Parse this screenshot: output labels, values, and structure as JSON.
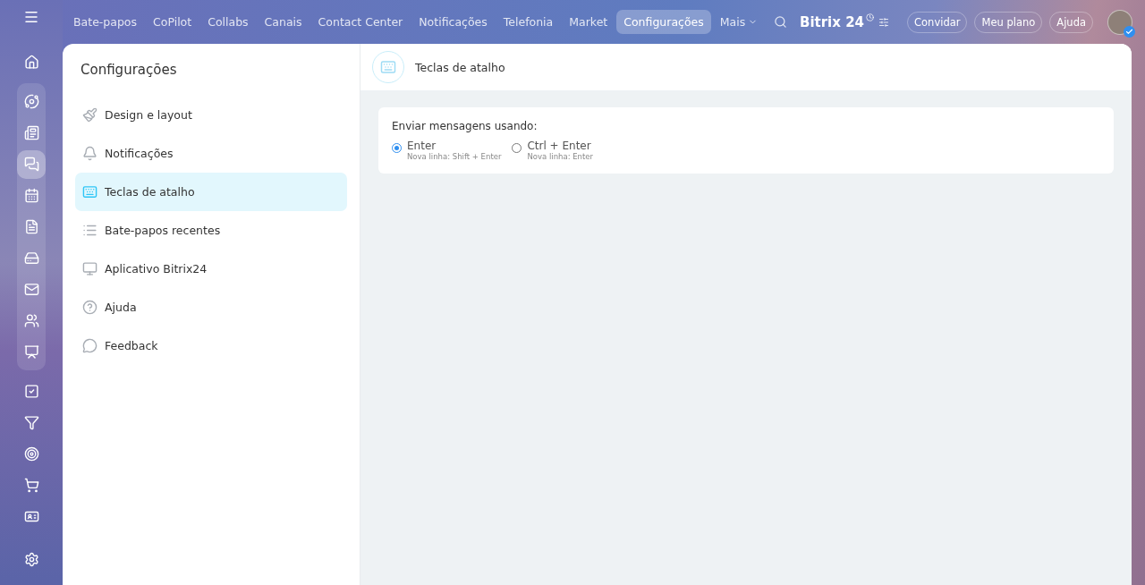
{
  "rail": {
    "top": [
      {
        "kind": "home",
        "selected": false
      }
    ],
    "group": [
      {
        "kind": "collab",
        "selected": false
      },
      {
        "kind": "feed",
        "selected": false
      },
      {
        "kind": "chat",
        "selected": true
      },
      {
        "kind": "calendar",
        "selected": false
      },
      {
        "kind": "document",
        "selected": false
      },
      {
        "kind": "drive",
        "selected": false
      },
      {
        "kind": "mail",
        "selected": false
      },
      {
        "kind": "people",
        "selected": false
      },
      {
        "kind": "board",
        "selected": false
      }
    ],
    "bottom": [
      {
        "kind": "tasks",
        "selected": false
      },
      {
        "kind": "funnel",
        "selected": false
      },
      {
        "kind": "target",
        "selected": false
      },
      {
        "kind": "cart",
        "selected": false
      },
      {
        "kind": "card",
        "selected": false
      }
    ]
  },
  "topnav": {
    "items": [
      {
        "label": "Bate-papos",
        "selected": false
      },
      {
        "label": "CoPilot",
        "selected": false
      },
      {
        "label": "Collabs",
        "selected": false
      },
      {
        "label": "Canais",
        "selected": false
      },
      {
        "label": "Contact Center",
        "selected": false
      },
      {
        "label": "Notificações",
        "selected": false
      },
      {
        "label": "Telefonia",
        "selected": false
      },
      {
        "label": "Market",
        "selected": false
      },
      {
        "label": "Configurações",
        "selected": true
      }
    ],
    "more": "Mais",
    "logo": "Bitrix",
    "logo_number": "24",
    "buttons": [
      "Convidar",
      "Meu plano",
      "Ajuda"
    ]
  },
  "settings": {
    "title": "Configurações",
    "items": [
      {
        "label": "Design e layout",
        "kind": "brush",
        "selected": false
      },
      {
        "label": "Notificações",
        "kind": "bell",
        "selected": false
      },
      {
        "label": "Teclas de atalho",
        "kind": "keyboard",
        "selected": true
      },
      {
        "label": "Bate-papos recentes",
        "kind": "list",
        "selected": false
      },
      {
        "label": "Aplicativo Bitrix24",
        "kind": "monitor",
        "selected": false
      },
      {
        "label": "Ajuda",
        "kind": "help",
        "selected": false
      },
      {
        "label": "Feedback",
        "kind": "bubble",
        "selected": false
      }
    ]
  },
  "content": {
    "title": "Teclas de atalho",
    "section": "Enviar mensagens usando:",
    "options": [
      {
        "label": "Enter",
        "hint": "Nova linha: Shift + Enter",
        "selected": true
      },
      {
        "label": "Ctrl + Enter",
        "hint": "Nova linha: Enter",
        "selected": false
      }
    ]
  }
}
